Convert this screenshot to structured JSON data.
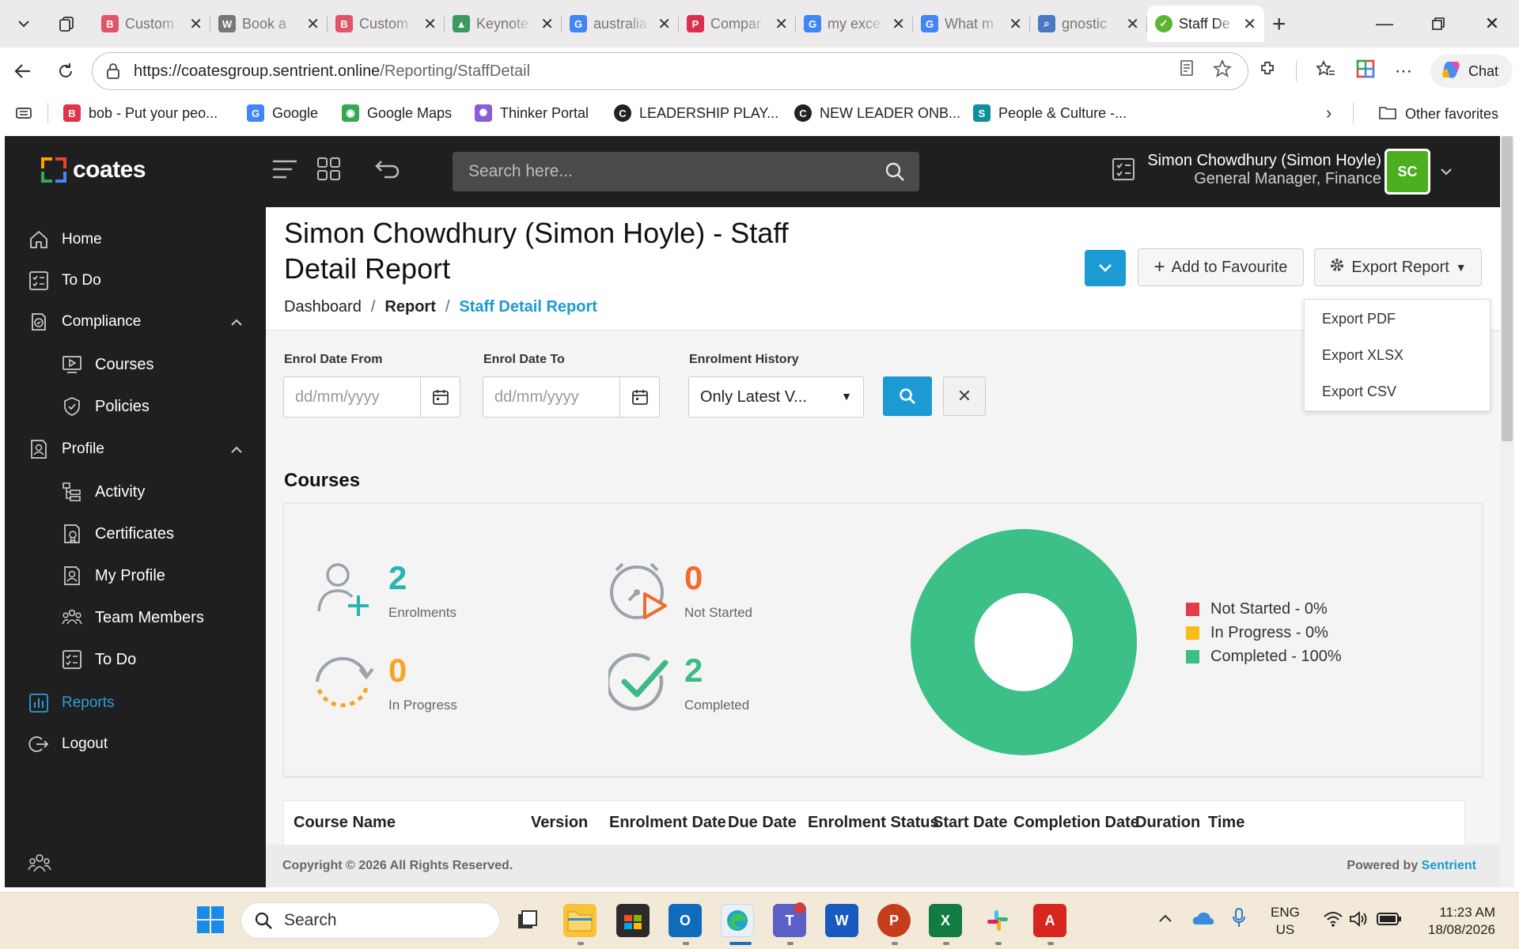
{
  "browser": {
    "tabs": [
      {
        "label": "Custom",
        "icon": "b-icon",
        "color": "#e05568",
        "letter": "B"
      },
      {
        "label": "Book a",
        "icon": "wordpress-icon",
        "color": "#777",
        "letter": "W"
      },
      {
        "label": "Custom",
        "icon": "b-icon",
        "color": "#e05568",
        "letter": "B"
      },
      {
        "label": "Keynote",
        "icon": "drive-icon",
        "color": "#3c9a5f",
        "letter": "▲"
      },
      {
        "label": "australia",
        "icon": "google-icon",
        "color": "#4285f4",
        "letter": "G"
      },
      {
        "label": "Compar",
        "icon": "p-icon",
        "color": "#d9304d",
        "letter": "P"
      },
      {
        "label": "my exce",
        "icon": "google-icon",
        "color": "#4285f4",
        "letter": "G"
      },
      {
        "label": "What m",
        "icon": "google-icon",
        "color": "#4285f4",
        "letter": "G"
      },
      {
        "label": "gnostic",
        "icon": "search-icon",
        "color": "#4a78c2",
        "letter": "⌕"
      },
      {
        "label": "Staff De",
        "icon": "check-circle-icon",
        "color": "#5cb531",
        "letter": "✓"
      }
    ],
    "url_host": "https://coatesgroup.sentrient.online",
    "url_path": "/Reporting/StaffDetail",
    "chat_label": "Chat",
    "favorites": [
      {
        "label": "bob - Put your peo...",
        "color": "#e0344b",
        "letter": "B"
      },
      {
        "label": "Google",
        "color": "#4285f4",
        "letter": "G"
      },
      {
        "label": "Google Maps",
        "color": "#34a853",
        "letter": "◉"
      },
      {
        "label": "Thinker Portal",
        "color": "#8a5bd6",
        "letter": "✺"
      },
      {
        "label": "LEADERSHIP PLAY...",
        "color": "#222",
        "letter": "C"
      },
      {
        "label": "NEW LEADER ONB...",
        "color": "#222",
        "letter": "C"
      },
      {
        "label": "People & Culture -...",
        "color": "#0f8f9c",
        "letter": "S"
      }
    ],
    "other_favorites": "Other favorites"
  },
  "app": {
    "logo_text": "coates",
    "search_placeholder": "Search here...",
    "user_name": "Simon Chowdhury (Simon Hoyle)",
    "user_role": "General Manager, Finance",
    "avatar_initials": "SC",
    "sidebar": {
      "home": "Home",
      "todo": "To Do",
      "compliance": "Compliance",
      "courses": "Courses",
      "policies": "Policies",
      "profile": "Profile",
      "activity": "Activity",
      "certificates": "Certificates",
      "my_profile": "My Profile",
      "team_members": "Team Members",
      "profile_todo": "To Do",
      "reports": "Reports",
      "logout": "Logout"
    },
    "page": {
      "title": "Simon Chowdhury (Simon Hoyle) - Staff Detail Report",
      "breadcrumb": [
        "Dashboard",
        "Report",
        "Staff Detail Report"
      ],
      "add_favourite": "Add to Favourite",
      "export_report": "Export Report",
      "export_menu": [
        "Export PDF",
        "Export XLSX",
        "Export CSV"
      ]
    },
    "filters": {
      "enrol_from_label": "Enrol Date From",
      "enrol_to_label": "Enrol Date To",
      "history_label": "Enrolment History",
      "date_placeholder": "dd/mm/yyyy",
      "history_value": "Only Latest V..."
    },
    "courses": {
      "heading": "Courses",
      "stats": [
        {
          "value": "2",
          "label": "Enrolments",
          "color": "#27b3b0"
        },
        {
          "value": "0",
          "label": "Not Started",
          "color": "#f26b2b"
        },
        {
          "value": "0",
          "label": "In Progress",
          "color": "#f5a623"
        },
        {
          "value": "2",
          "label": "Completed",
          "color": "#3aba84"
        }
      ]
    },
    "table_headers": [
      "Course Name",
      "Version",
      "Enrolment Date",
      "Due Date",
      "Enrolment Status",
      "Start Date",
      "Completion Date",
      "Duration",
      "Time"
    ],
    "footer": {
      "copyright": "Copyright © 2026 All Rights Reserved.",
      "powered_prefix": "Powered by ",
      "powered_brand": "Sentrient"
    }
  },
  "chart_data": {
    "type": "pie",
    "categories": [
      "Not Started - 0%",
      "In Progress - 0%",
      "Completed - 100%"
    ],
    "values": [
      0,
      0,
      100
    ],
    "colors": [
      "#e03c4a",
      "#f7be19",
      "#3dbf88"
    ],
    "legend_position": "right",
    "donut": true
  },
  "taskbar": {
    "search_label": "Search",
    "lang_line1": "ENG",
    "lang_line2": "US",
    "time": "11:23 AM",
    "date": "18/08/2026"
  }
}
